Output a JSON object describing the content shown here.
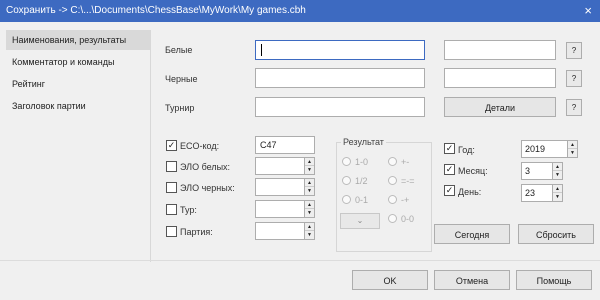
{
  "window": {
    "title": "Сохранить -> C:\\...\\Documents\\ChessBase\\MyWork\\My games.cbh",
    "close_glyph": "×"
  },
  "sidebar": {
    "items": [
      {
        "label": "Наименования, результаты",
        "active": true
      },
      {
        "label": "Комментатор и команды"
      },
      {
        "label": "Рейтинг"
      },
      {
        "label": "Заголовок партии"
      }
    ]
  },
  "players": {
    "white_label": "Белые",
    "white_value": "",
    "white_extra": "",
    "black_label": "Черные",
    "black_value": "",
    "black_extra": "",
    "tournament_label": "Турнир",
    "tournament_value": "",
    "details_button": "Детали",
    "help_glyph": "?"
  },
  "checks": [
    {
      "label": "ECO-код:",
      "checked": true,
      "value": "C47"
    },
    {
      "label": "ЭЛО белых:",
      "checked": false,
      "value": ""
    },
    {
      "label": "ЭЛО черных:",
      "checked": false,
      "value": ""
    },
    {
      "label": "Тур:",
      "checked": false,
      "value": ""
    },
    {
      "label": "Партия:",
      "checked": false,
      "value": ""
    }
  ],
  "result": {
    "title": "Результат",
    "options": [
      "1-0",
      "+-",
      "1/2",
      "=-=",
      "0-1",
      "-+",
      "",
      "0-0"
    ],
    "dropdown_glyph": "⌄"
  },
  "date": {
    "year_label": "Год:",
    "year_value": "2019",
    "year_checked": true,
    "month_label": "Месяц:",
    "month_value": "3",
    "month_checked": true,
    "day_label": "День:",
    "day_value": "23",
    "day_checked": true,
    "today_button": "Сегодня",
    "reset_button": "Сбросить"
  },
  "footer": {
    "ok": "OK",
    "cancel": "Отмена",
    "help": "Помощь"
  },
  "glyphs": {
    "check": "✓",
    "spin_up": "▲",
    "spin_down": "▼"
  },
  "colors": {
    "titlebar": "#3d6ac1",
    "active_tab": "#d9d9d9"
  }
}
